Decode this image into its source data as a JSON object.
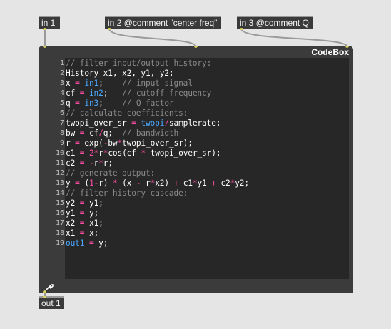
{
  "inlets": [
    {
      "label": "in 1"
    },
    {
      "label": "in 2 @comment \"center freq\""
    },
    {
      "label": "in 3 @comment Q"
    }
  ],
  "outlet": {
    "label": "out 1"
  },
  "codebox": {
    "title": "CodeBox",
    "lines": [
      {
        "n": "1",
        "tokens": [
          [
            "c",
            "// filter input/output history:"
          ]
        ]
      },
      {
        "n": "2",
        "tokens": [
          [
            "t",
            "History x1, x2, y1, y2;"
          ]
        ]
      },
      {
        "n": "3",
        "tokens": [
          [
            "t",
            "x "
          ],
          [
            "o",
            "="
          ],
          [
            "t",
            " "
          ],
          [
            "i",
            "in1"
          ],
          [
            "t",
            ";    "
          ],
          [
            "c",
            "// input signal"
          ]
        ]
      },
      {
        "n": "4",
        "tokens": [
          [
            "t",
            "cf "
          ],
          [
            "o",
            "="
          ],
          [
            "t",
            " "
          ],
          [
            "i",
            "in2"
          ],
          [
            "t",
            ";   "
          ],
          [
            "c",
            "// cutoff frequency"
          ]
        ]
      },
      {
        "n": "5",
        "tokens": [
          [
            "t",
            "q "
          ],
          [
            "o",
            "="
          ],
          [
            "t",
            " "
          ],
          [
            "i",
            "in3"
          ],
          [
            "t",
            ";    "
          ],
          [
            "c",
            "// Q factor"
          ]
        ]
      },
      {
        "n": "6",
        "tokens": [
          [
            "c",
            "// calculate coefficients:"
          ]
        ]
      },
      {
        "n": "7",
        "tokens": [
          [
            "t",
            "twopi_over_sr "
          ],
          [
            "o",
            "="
          ],
          [
            "t",
            " "
          ],
          [
            "i",
            "twopi"
          ],
          [
            "o",
            "/"
          ],
          [
            "t",
            "samplerate;"
          ]
        ]
      },
      {
        "n": "8",
        "tokens": [
          [
            "t",
            "bw "
          ],
          [
            "o",
            "="
          ],
          [
            "t",
            " cf"
          ],
          [
            "o",
            "/"
          ],
          [
            "t",
            "q;  "
          ],
          [
            "c",
            "// bandwidth"
          ]
        ]
      },
      {
        "n": "9",
        "tokens": [
          [
            "t",
            "r "
          ],
          [
            "o",
            "="
          ],
          [
            "t",
            " exp("
          ],
          [
            "o",
            "-"
          ],
          [
            "t",
            "bw"
          ],
          [
            "o",
            "*"
          ],
          [
            "t",
            "twopi_over_sr);"
          ]
        ]
      },
      {
        "n": "10",
        "tokens": [
          [
            "t",
            "c1 "
          ],
          [
            "o",
            "="
          ],
          [
            "t",
            " "
          ],
          [
            "o",
            "2"
          ],
          [
            "o",
            "*"
          ],
          [
            "t",
            "r"
          ],
          [
            "o",
            "*"
          ],
          [
            "t",
            "cos(cf "
          ],
          [
            "o",
            "*"
          ],
          [
            "t",
            " twopi_over_sr);"
          ]
        ]
      },
      {
        "n": "11",
        "tokens": [
          [
            "t",
            "c2 "
          ],
          [
            "o",
            "="
          ],
          [
            "t",
            " "
          ],
          [
            "o",
            "-"
          ],
          [
            "t",
            "r"
          ],
          [
            "o",
            "*"
          ],
          [
            "t",
            "r;"
          ]
        ]
      },
      {
        "n": "12",
        "tokens": [
          [
            "c",
            "// generate output:"
          ]
        ]
      },
      {
        "n": "13",
        "tokens": [
          [
            "t",
            "y "
          ],
          [
            "o",
            "="
          ],
          [
            "t",
            " ("
          ],
          [
            "o",
            "1"
          ],
          [
            "o",
            "-"
          ],
          [
            "t",
            "r) "
          ],
          [
            "o",
            "*"
          ],
          [
            "t",
            " (x "
          ],
          [
            "o",
            "-"
          ],
          [
            "t",
            " r"
          ],
          [
            "o",
            "*"
          ],
          [
            "t",
            "x2) "
          ],
          [
            "o",
            "+"
          ],
          [
            "t",
            " c1"
          ],
          [
            "o",
            "*"
          ],
          [
            "t",
            "y1 "
          ],
          [
            "o",
            "+"
          ],
          [
            "t",
            " c2"
          ],
          [
            "o",
            "*"
          ],
          [
            "t",
            "y2;"
          ]
        ]
      },
      {
        "n": "14",
        "tokens": [
          [
            "c",
            "// filter history cascade:"
          ]
        ]
      },
      {
        "n": "15",
        "tokens": [
          [
            "t",
            "y2 "
          ],
          [
            "o",
            "="
          ],
          [
            "t",
            " y1;"
          ]
        ]
      },
      {
        "n": "16",
        "tokens": [
          [
            "t",
            "y1 "
          ],
          [
            "o",
            "="
          ],
          [
            "t",
            " y;"
          ]
        ]
      },
      {
        "n": "17",
        "tokens": [
          [
            "t",
            "x2 "
          ],
          [
            "o",
            "="
          ],
          [
            "t",
            " x1;"
          ]
        ]
      },
      {
        "n": "18",
        "tokens": [
          [
            "t",
            "x1 "
          ],
          [
            "o",
            "="
          ],
          [
            "t",
            " x;"
          ]
        ]
      },
      {
        "n": "19",
        "tokens": [
          [
            "i",
            "out1"
          ],
          [
            "t",
            " "
          ],
          [
            "o",
            "="
          ],
          [
            "t",
            " y;"
          ]
        ]
      }
    ]
  },
  "colors": {
    "background": "#e5e5e5",
    "object": "#3a3a3a",
    "editor": "#272727",
    "comment": "#8a8a8a",
    "operator": "#ff4da6",
    "io_keyword": "#4aa8ff",
    "port": "#d8d060"
  },
  "icons": {
    "lock": "wrench-icon"
  }
}
